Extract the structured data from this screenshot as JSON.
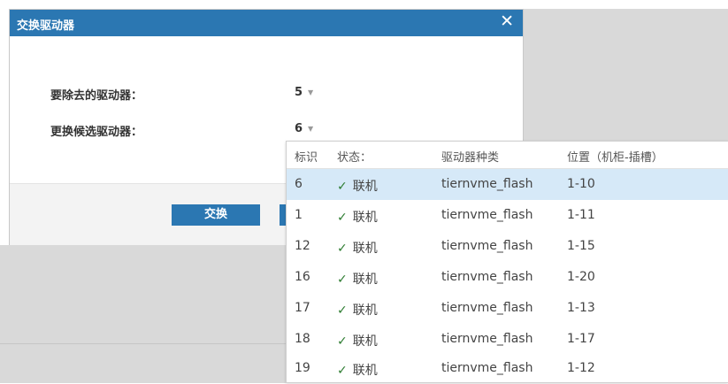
{
  "dialog": {
    "title": "交换驱动器",
    "close_icon": "✕",
    "remove_label": "要除去的驱动器：",
    "remove_value": "5",
    "replace_label": "更换候选驱动器：",
    "replace_value": "6",
    "exchange_button": "交换"
  },
  "dropdown": {
    "headers": [
      "标识",
      "状态：",
      "驱动器种类",
      "位置（机柜-插槽）"
    ],
    "rows": [
      {
        "id": "6",
        "status": "联机",
        "type": "tiernvme_flash",
        "location": "1-10",
        "selected": true
      },
      {
        "id": "1",
        "status": "联机",
        "type": "tiernvme_flash",
        "location": "1-11"
      },
      {
        "id": "12",
        "status": "联机",
        "type": "tiernvme_flash",
        "location": "1-15"
      },
      {
        "id": "16",
        "status": "联机",
        "type": "tiernvme_flash",
        "location": "1-20"
      },
      {
        "id": "17",
        "status": "联机",
        "type": "tiernvme_flash",
        "location": "1-13"
      },
      {
        "id": "18",
        "status": "联机",
        "type": "tiernvme_flash",
        "location": "1-17"
      },
      {
        "id": "19",
        "status": "联机",
        "type": "tiernvme_flash",
        "location": "1-12"
      }
    ]
  },
  "icons": {
    "caret": "▼",
    "check": "✓"
  },
  "colors": {
    "accent": "#2b77b2",
    "selected_row": "#d6e9f8",
    "check": "#2e7d32"
  }
}
